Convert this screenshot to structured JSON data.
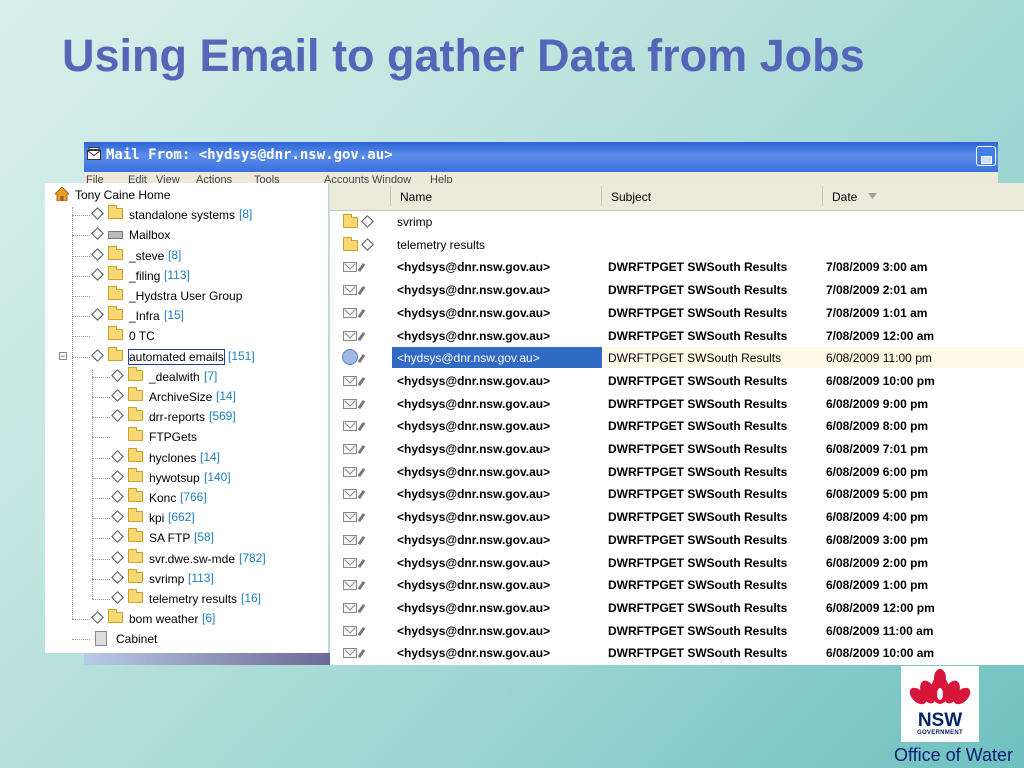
{
  "slide": {
    "title": "Using Email to gather Data from Jobs",
    "footer": "Office of Water",
    "logo": {
      "text": "NSW",
      "subtext": "GOVERNMENT"
    }
  },
  "window": {
    "title": "Mail From: <hydsys@dnr.nsw.gov.au>",
    "menu": [
      "File",
      "Edit",
      "View",
      "Actions",
      "Tools",
      "Accounts",
      "Window",
      "Help"
    ]
  },
  "folder_tree": [
    {
      "label": "Tony Caine Home",
      "count": "",
      "icon": "home-icon",
      "level": 0
    },
    {
      "label": "standalone systems",
      "count": "[8]",
      "icon": "folder-icon",
      "level": 1
    },
    {
      "label": "Mailbox",
      "count": "",
      "icon": "mailbox-icon",
      "level": 1
    },
    {
      "label": "_steve",
      "count": "[8]",
      "icon": "folder-icon",
      "level": 1
    },
    {
      "label": "_filing",
      "count": "[113]",
      "icon": "folder-icon",
      "level": 1
    },
    {
      "label": "_Hydstra User Group",
      "count": "",
      "icon": "folder-icon",
      "level": 1
    },
    {
      "label": "_Infra",
      "count": "[15]",
      "icon": "folder-icon",
      "level": 1
    },
    {
      "label": "0 TC",
      "count": "",
      "icon": "folder-icon",
      "level": 1
    },
    {
      "label": "automated emails",
      "count": "[151]",
      "icon": "folder-icon",
      "level": 1,
      "selected": true
    },
    {
      "label": "_dealwith",
      "count": "[7]",
      "icon": "folder-icon",
      "level": 2
    },
    {
      "label": "ArchiveSize",
      "count": "[14]",
      "icon": "folder-icon",
      "level": 2
    },
    {
      "label": "drr-reports",
      "count": "[569]",
      "icon": "folder-icon",
      "level": 2
    },
    {
      "label": "FTPGets",
      "count": "",
      "icon": "folder-icon",
      "level": 2
    },
    {
      "label": "hyclones",
      "count": "[14]",
      "icon": "folder-icon",
      "level": 2
    },
    {
      "label": "hywotsup",
      "count": "[140]",
      "icon": "folder-icon",
      "level": 2
    },
    {
      "label": "Konc",
      "count": "[766]",
      "icon": "folder-icon",
      "level": 2
    },
    {
      "label": "kpi",
      "count": "[662]",
      "icon": "folder-icon",
      "level": 2
    },
    {
      "label": "SA FTP",
      "count": "[58]",
      "icon": "folder-icon",
      "level": 2
    },
    {
      "label": "svr.dwe.sw-mde",
      "count": "[782]",
      "icon": "folder-icon",
      "level": 2
    },
    {
      "label": "svrimp",
      "count": "[113]",
      "icon": "folder-icon",
      "level": 2
    },
    {
      "label": "telemetry results",
      "count": "[16]",
      "icon": "folder-icon",
      "level": 2
    },
    {
      "label": "bom weather",
      "count": "[6]",
      "icon": "folder-icon",
      "level": 1
    },
    {
      "label": "Cabinet",
      "count": "",
      "icon": "cabinet-icon",
      "level": 1
    }
  ],
  "message_list": {
    "columns": {
      "name": "Name",
      "subject": "Subject",
      "date": "Date"
    },
    "rows": [
      {
        "type": "folder",
        "name": "svrimp",
        "subject": "",
        "date": ""
      },
      {
        "type": "folder",
        "name": "telemetry results",
        "subject": "",
        "date": ""
      },
      {
        "type": "mail",
        "name": "<hydsys@dnr.nsw.gov.au>",
        "subject": "DWRFTPGET SWSouth Results",
        "date": "7/08/2009 3:00 am",
        "unread": true
      },
      {
        "type": "mail",
        "name": "<hydsys@dnr.nsw.gov.au>",
        "subject": "DWRFTPGET SWSouth Results",
        "date": "7/08/2009 2:01 am",
        "unread": true
      },
      {
        "type": "mail",
        "name": "<hydsys@dnr.nsw.gov.au>",
        "subject": "DWRFTPGET SWSouth Results",
        "date": "7/08/2009 1:01 am",
        "unread": true
      },
      {
        "type": "mail",
        "name": "<hydsys@dnr.nsw.gov.au>",
        "subject": "DWRFTPGET SWSouth Results",
        "date": "7/08/2009 12:00 am",
        "unread": true
      },
      {
        "type": "mail",
        "name": "<hydsys@dnr.nsw.gov.au>",
        "subject": "DWRFTPGET SWSouth Results",
        "date": "6/08/2009 11:00 pm",
        "unread": false,
        "selected": true
      },
      {
        "type": "mail",
        "name": "<hydsys@dnr.nsw.gov.au>",
        "subject": "DWRFTPGET SWSouth Results",
        "date": "6/08/2009 10:00 pm",
        "unread": true
      },
      {
        "type": "mail",
        "name": "<hydsys@dnr.nsw.gov.au>",
        "subject": "DWRFTPGET SWSouth Results",
        "date": "6/08/2009 9:00 pm",
        "unread": true
      },
      {
        "type": "mail",
        "name": "<hydsys@dnr.nsw.gov.au>",
        "subject": "DWRFTPGET SWSouth Results",
        "date": "6/08/2009 8:00 pm",
        "unread": true
      },
      {
        "type": "mail",
        "name": "<hydsys@dnr.nsw.gov.au>",
        "subject": "DWRFTPGET SWSouth Results",
        "date": "6/08/2009 7:01 pm",
        "unread": true
      },
      {
        "type": "mail",
        "name": "<hydsys@dnr.nsw.gov.au>",
        "subject": "DWRFTPGET SWSouth Results",
        "date": "6/08/2009 6:00 pm",
        "unread": true
      },
      {
        "type": "mail",
        "name": "<hydsys@dnr.nsw.gov.au>",
        "subject": "DWRFTPGET SWSouth Results",
        "date": "6/08/2009 5:00 pm",
        "unread": true
      },
      {
        "type": "mail",
        "name": "<hydsys@dnr.nsw.gov.au>",
        "subject": "DWRFTPGET SWSouth Results",
        "date": "6/08/2009 4:00 pm",
        "unread": true
      },
      {
        "type": "mail",
        "name": "<hydsys@dnr.nsw.gov.au>",
        "subject": "DWRFTPGET SWSouth Results",
        "date": "6/08/2009 3:00 pm",
        "unread": true
      },
      {
        "type": "mail",
        "name": "<hydsys@dnr.nsw.gov.au>",
        "subject": "DWRFTPGET SWSouth Results",
        "date": "6/08/2009 2:00 pm",
        "unread": true
      },
      {
        "type": "mail",
        "name": "<hydsys@dnr.nsw.gov.au>",
        "subject": "DWRFTPGET SWSouth Results",
        "date": "6/08/2009 1:00 pm",
        "unread": true
      },
      {
        "type": "mail",
        "name": "<hydsys@dnr.nsw.gov.au>",
        "subject": "DWRFTPGET SWSouth Results",
        "date": "6/08/2009 12:00 pm",
        "unread": true
      },
      {
        "type": "mail",
        "name": "<hydsys@dnr.nsw.gov.au>",
        "subject": "DWRFTPGET SWSouth Results",
        "date": "6/08/2009 11:00 am",
        "unread": true
      },
      {
        "type": "mail",
        "name": "<hydsys@dnr.nsw.gov.au>",
        "subject": "DWRFTPGET SWSouth Results",
        "date": "6/08/2009 10:00 am",
        "unread": true
      }
    ]
  }
}
